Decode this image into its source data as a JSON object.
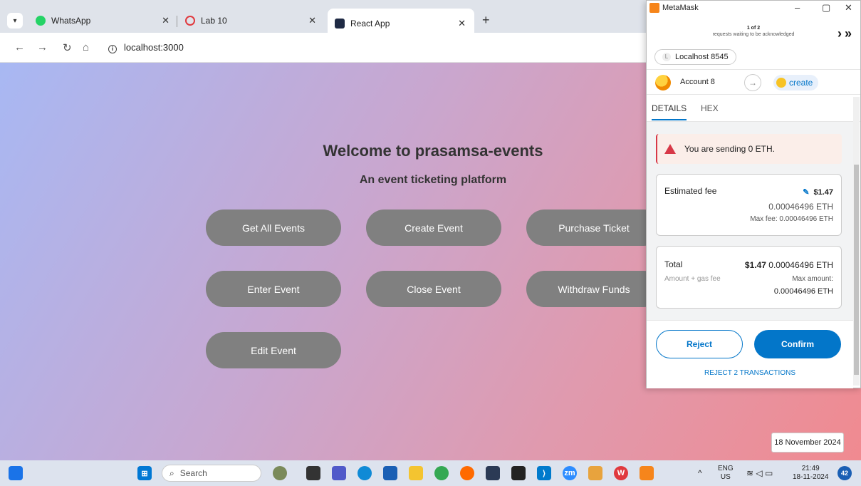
{
  "browser": {
    "tabs": [
      {
        "label": "WhatsApp",
        "color": "#25d366"
      },
      {
        "label": "Lab 10",
        "color": "#e0393e"
      },
      {
        "label": "React App",
        "color": "#1f2a44"
      }
    ],
    "url": "localhost:3000"
  },
  "page": {
    "title": "Welcome to prasamsa-events",
    "subtitle": "An event ticketing platform",
    "buttons": [
      "Get All Events",
      "Create Event",
      "Purchase Ticket",
      "Enter Event",
      "Close Event",
      "Withdraw Funds",
      "Edit Event"
    ],
    "date_tooltip": "18 November 2024"
  },
  "metamask": {
    "window_title": "MetaMask",
    "queue_count": "1 of 2",
    "queue_text": "requests waiting to be acknowledged",
    "network": "Localhost 8545",
    "network_initial": "L",
    "account": "Account 8",
    "method": "create",
    "tab_details": "DETAILS",
    "tab_hex": "HEX",
    "warning": "You are sending 0 ETH.",
    "fee_label": "Estimated fee",
    "fee_usd": "$1.47",
    "fee_eth": "0.00046496 ETH",
    "max_fee": "Max fee: 0.00046496 ETH",
    "total_label": "Total",
    "total_sub": "Amount + gas fee",
    "total_usd": "$1.47",
    "total_eth": "0.00046496 ETH",
    "max_amount_label": "Max amount:",
    "max_amount": "0.00046496 ETH",
    "reject": "Reject",
    "confirm": "Confirm",
    "reject_all": "REJECT 2 TRANSACTIONS",
    "accent": "#0376c9"
  },
  "taskbar": {
    "search": "Search",
    "lang": "ENG",
    "region": "US",
    "time": "21:49",
    "date": "18-11-2024",
    "badge": "42"
  }
}
